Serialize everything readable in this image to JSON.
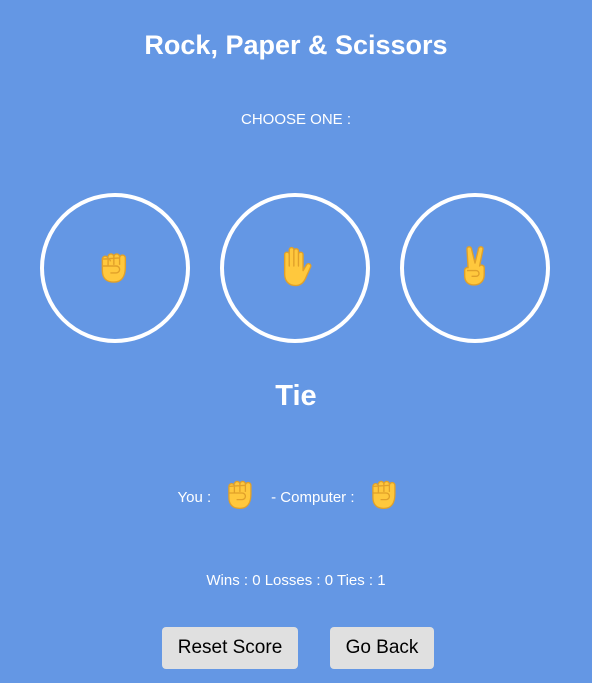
{
  "header": {
    "title": "Rock, Paper & Scissors"
  },
  "prompt": "CHOOSE ONE :",
  "choices": [
    {
      "id": "rock",
      "icon": "raised-fist-icon"
    },
    {
      "id": "paper",
      "icon": "raised-hand-icon"
    },
    {
      "id": "scissors",
      "icon": "victory-hand-icon"
    }
  ],
  "result": "Tie",
  "picks": {
    "you_label": "You :",
    "computer_label": "- Computer :",
    "you_icon": "raised-fist-icon",
    "computer_icon": "raised-fist-icon"
  },
  "score": {
    "text": "Wins : 0 Losses : 0 Ties : 1"
  },
  "buttons": {
    "reset": "Reset Score",
    "back": "Go Back"
  },
  "colors": {
    "background": "#6497e4",
    "hand": "#ffc83d",
    "hand_outline": "#e0a02a",
    "button": "#e0e0e0"
  }
}
